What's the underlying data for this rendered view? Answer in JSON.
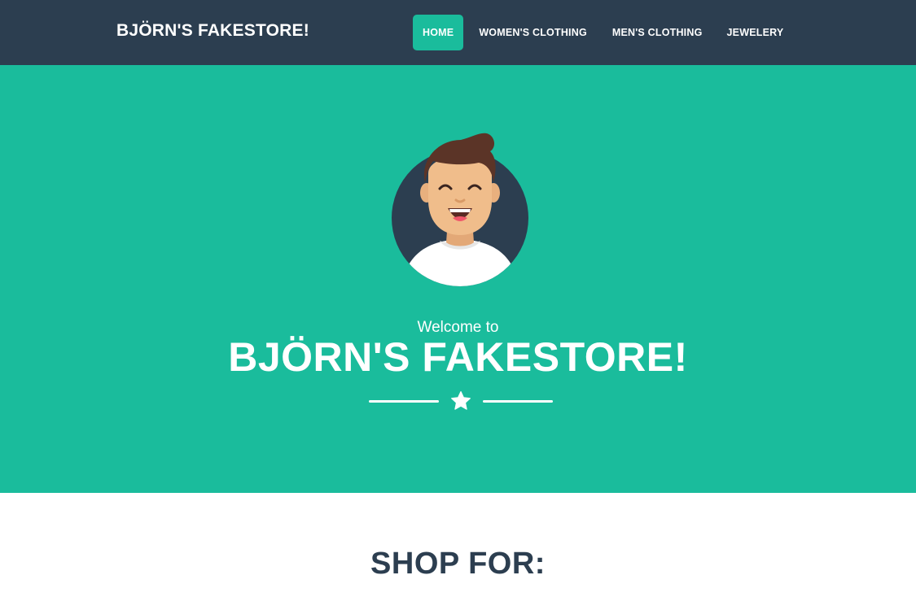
{
  "nav": {
    "brand": "BJÖRN'S FAKESTORE!",
    "links": [
      {
        "label": "HOME",
        "active": true
      },
      {
        "label": "WOMEN'S CLOTHING",
        "active": false
      },
      {
        "label": "MEN'S CLOTHING",
        "active": false
      },
      {
        "label": "JEWELERY",
        "active": false
      }
    ]
  },
  "hero": {
    "avatar_icon": "smiling-person-avatar",
    "subtitle": "Welcome to",
    "title": "BJÖRN'S FAKESTORE!",
    "divider_icon": "star-icon"
  },
  "shop": {
    "heading": "SHOP FOR:"
  },
  "colors": {
    "navbar": "#2c3e50",
    "accent": "#1abc9c",
    "text_light": "#ffffff",
    "heading_dark": "#2c3e50"
  }
}
